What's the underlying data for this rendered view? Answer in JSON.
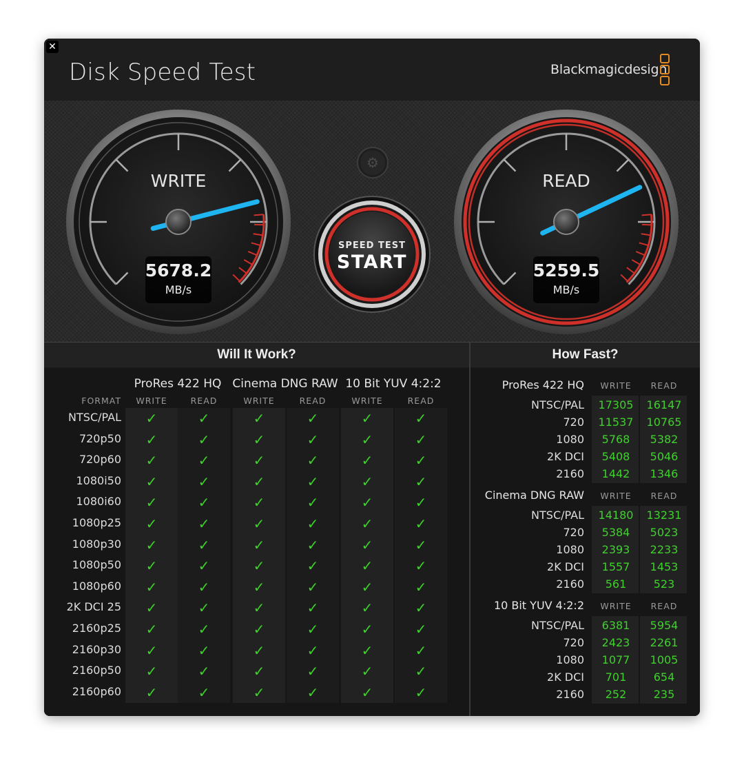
{
  "window": {
    "title": "Disk Speed Test",
    "brand": "Blackmagicdesign",
    "close_label": "✕",
    "accent": "#e38b22"
  },
  "gauges": {
    "write": {
      "label": "WRITE",
      "value": "5678.2",
      "unit": "MB/s",
      "needle_fraction": 0.78
    },
    "read": {
      "label": "READ",
      "value": "5259.5",
      "unit": "MB/s",
      "needle_fraction": 0.74
    }
  },
  "start_button": {
    "line1": "SPEED TEST",
    "line2": "START"
  },
  "settings_icon": "gear-icon",
  "will_it_work": {
    "title": "Will It Work?",
    "format_label": "FORMAT",
    "groups": [
      "ProRes 422 HQ",
      "Cinema DNG RAW",
      "10 Bit YUV 4:2:2"
    ],
    "subcols": [
      "WRITE",
      "READ"
    ],
    "check_glyph": "✓",
    "formats": [
      "NTSC/PAL",
      "720p50",
      "720p60",
      "1080i50",
      "1080i60",
      "1080p25",
      "1080p30",
      "1080p50",
      "1080p60",
      "2K DCI 25",
      "2160p25",
      "2160p30",
      "2160p50",
      "2160p60"
    ]
  },
  "how_fast": {
    "title": "How Fast?",
    "subcols": [
      "WRITE",
      "READ"
    ],
    "groups": [
      {
        "name": "ProRes 422 HQ",
        "rows": [
          {
            "label": "NTSC/PAL",
            "write": "17305",
            "read": "16147"
          },
          {
            "label": "720",
            "write": "11537",
            "read": "10765"
          },
          {
            "label": "1080",
            "write": "5768",
            "read": "5382"
          },
          {
            "label": "2K DCI",
            "write": "5408",
            "read": "5046"
          },
          {
            "label": "2160",
            "write": "1442",
            "read": "1346"
          }
        ]
      },
      {
        "name": "Cinema DNG RAW",
        "rows": [
          {
            "label": "NTSC/PAL",
            "write": "14180",
            "read": "13231"
          },
          {
            "label": "720",
            "write": "5384",
            "read": "5023"
          },
          {
            "label": "1080",
            "write": "2393",
            "read": "2233"
          },
          {
            "label": "2K DCI",
            "write": "1557",
            "read": "1453"
          },
          {
            "label": "2160",
            "write": "561",
            "read": "523"
          }
        ]
      },
      {
        "name": "10 Bit YUV 4:2:2",
        "rows": [
          {
            "label": "NTSC/PAL",
            "write": "6381",
            "read": "5954"
          },
          {
            "label": "720",
            "write": "2423",
            "read": "2261"
          },
          {
            "label": "1080",
            "write": "1077",
            "read": "1005"
          },
          {
            "label": "2K DCI",
            "write": "701",
            "read": "654"
          },
          {
            "label": "2160",
            "write": "252",
            "read": "235"
          }
        ]
      }
    ]
  },
  "colors": {
    "check_green": "#3fd12c",
    "needle_blue": "#1fb4f2",
    "red_ring": "#d0302a"
  }
}
